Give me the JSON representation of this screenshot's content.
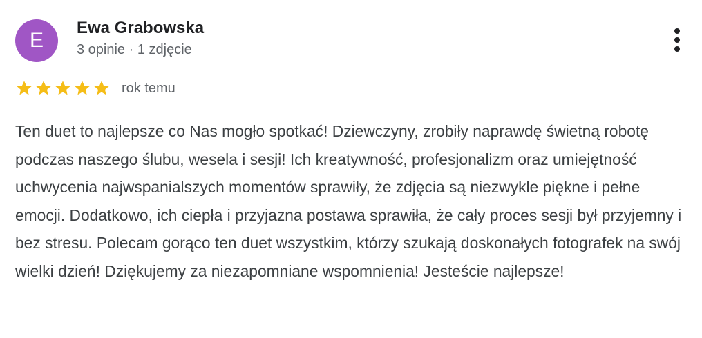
{
  "review": {
    "author": {
      "initial": "E",
      "name": "Ewa Grabowska",
      "meta": "3 opinie · 1 zdjęcie",
      "avatar_color": "#a056c5"
    },
    "rating": {
      "stars": 5,
      "max_stars": 5,
      "star_color": "#f5bd17"
    },
    "date": "rok temu",
    "text": "Ten duet to najlepsze co Nas mogło spotkać! Dziewczyny, zrobiły naprawdę świetną robotę podczas naszego ślubu, wesela i sesji! Ich kreatywność, profesjonalizm oraz umiejętność uchwycenia najwspanialszych momentów sprawiły, że zdjęcia są niezwykle piękne i pełne emocji. Dodatkowo, ich ciepła i przyjazna postawa sprawiła, że cały proces sesji był przyjemny i bez stresu. Polecam gorąco ten duet wszystkim, którzy szukają doskonałych fotografek na swój wielki dzień! Dziękujemy za niezapomniane wspomnienia! Jesteście najlepsze!",
    "more_icon": "more-vert-icon"
  }
}
